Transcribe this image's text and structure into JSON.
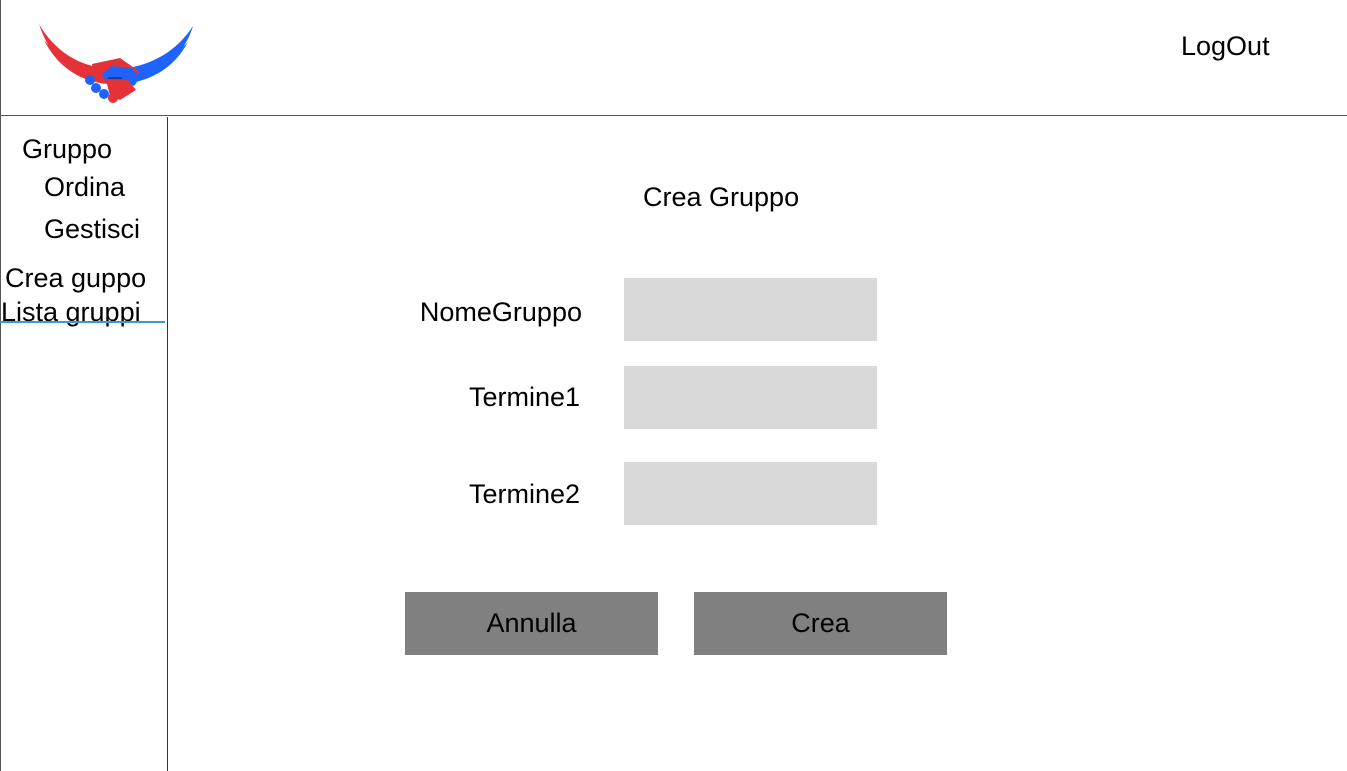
{
  "header": {
    "logo_icon": "handshake-wings-logo",
    "logo_colors": [
      "#e53238",
      "#1f63ff"
    ],
    "logout_label": "LogOut"
  },
  "sidebar": {
    "section_label": "Gruppo",
    "items": [
      {
        "label": "Ordina"
      },
      {
        "label": "Gestisci"
      },
      {
        "label": "Crea guppo"
      },
      {
        "label": "Lista gruppi",
        "active": true
      }
    ],
    "active_underline_color": "#3a9ad9"
  },
  "form": {
    "title": "Crea Gruppo",
    "fields": [
      {
        "label": "NomeGruppo",
        "value": ""
      },
      {
        "label": "Termine1",
        "value": ""
      },
      {
        "label": "Termine2",
        "value": ""
      }
    ],
    "cancel_label": "Annulla",
    "submit_label": "Crea"
  }
}
